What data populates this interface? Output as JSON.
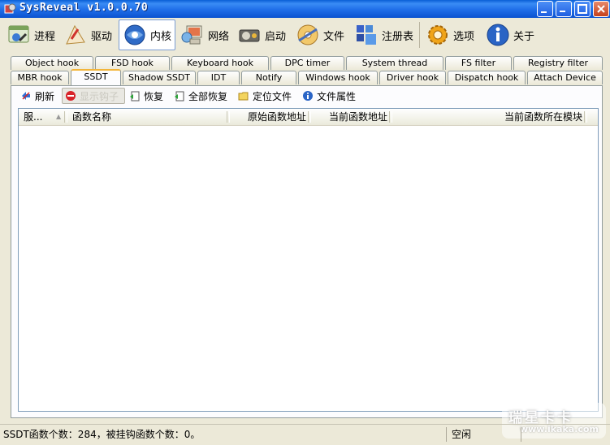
{
  "window": {
    "title": "SysReveal v1.0.0.70",
    "controls": {
      "minimize": "minimize-icon",
      "restore": "restore-icon",
      "maximize": "maximize-icon",
      "close": "close-icon"
    }
  },
  "toolbar": {
    "items": [
      {
        "label": "进程",
        "icon": "process-icon"
      },
      {
        "label": "驱动",
        "icon": "driver-icon"
      },
      {
        "label": "内核",
        "icon": "kernel-icon",
        "active": true
      },
      {
        "label": "网络",
        "icon": "network-icon"
      },
      {
        "label": "启动",
        "icon": "startup-icon"
      },
      {
        "label": "文件",
        "icon": "file-icon"
      },
      {
        "label": "注册表",
        "icon": "registry-icon"
      },
      {
        "label": "选项",
        "icon": "options-icon"
      },
      {
        "label": "关于",
        "icon": "about-icon"
      }
    ]
  },
  "tabs": {
    "row1": [
      "Object hook",
      "FSD hook",
      "Keyboard hook",
      "DPC timer",
      "System thread",
      "FS filter",
      "Registry filter"
    ],
    "row2": [
      "MBR hook",
      "SSDT",
      "Shadow SSDT",
      "IDT",
      "Notify",
      "Windows hook",
      "Driver hook",
      "Dispatch hook",
      "Attach Device"
    ],
    "active": "SSDT"
  },
  "subtoolbar": {
    "refresh": "刷新",
    "show_hooks": "显示钩子",
    "restore": "恢复",
    "restore_all": "全部恢复",
    "locate_file": "定位文件",
    "file_properties": "文件属性"
  },
  "listview": {
    "columns": [
      "服...",
      "函数名称",
      "原始函数地址",
      "当前函数地址",
      "当前函数所在模块"
    ],
    "rows": []
  },
  "statusbar": {
    "info": "SSDT函数个数：284，被挂钩函数个数：0。",
    "state": "空闲"
  },
  "watermark": {
    "text": "瑞星卡卡",
    "url": "www.ikaka.com"
  },
  "colors": {
    "titlebar": "#1f6ee8",
    "window_bg": "#ece9d8",
    "tab_highlight": "#f3b53a"
  }
}
